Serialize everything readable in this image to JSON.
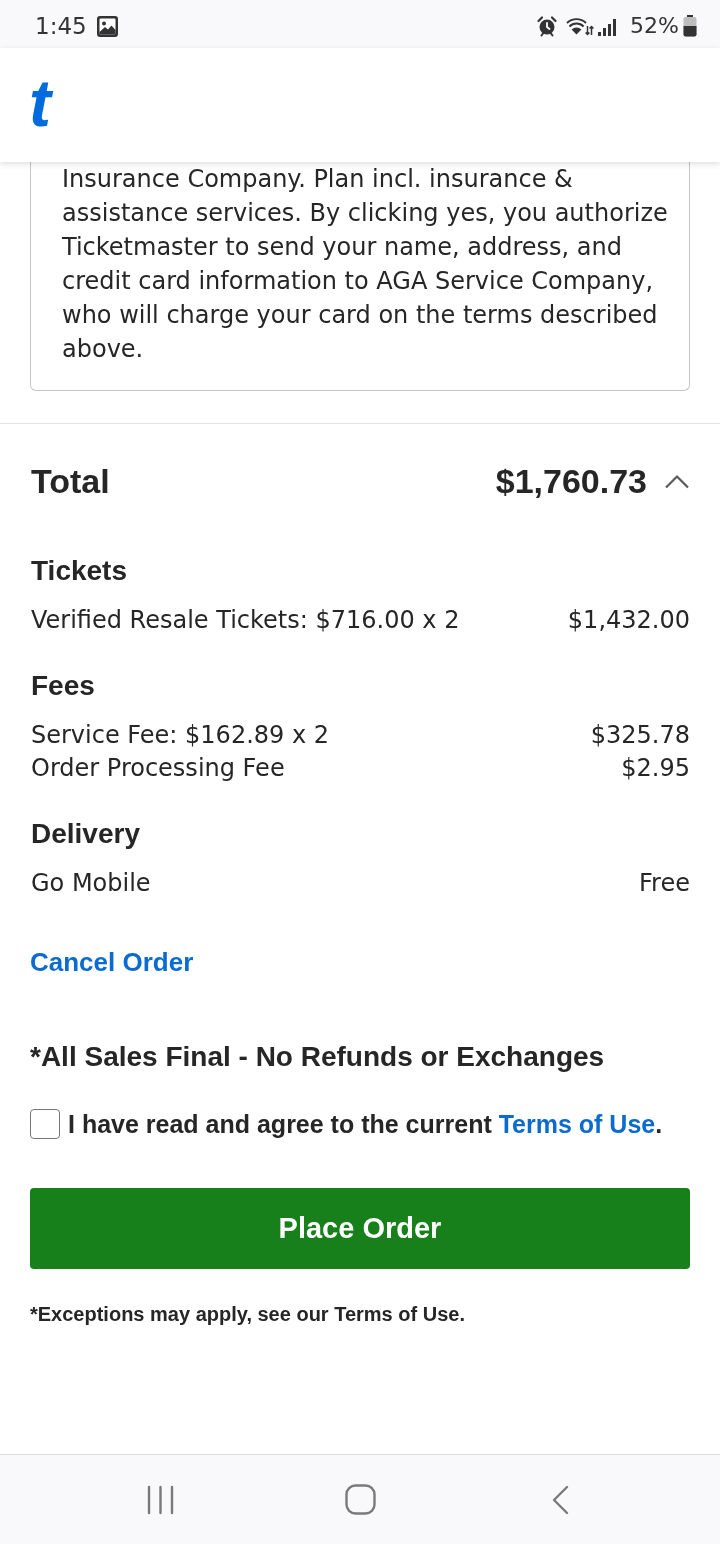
{
  "status_bar": {
    "time": "1:45",
    "battery": "52%"
  },
  "header": {
    "logo": "t"
  },
  "insurance_notice": {
    "text": "Insurance Company. Plan incl. insurance & assistance services. By clicking yes, you authorize Ticketmaster to send your name, address, and credit card information to AGA Service Company, who will charge your card on the terms described above."
  },
  "total": {
    "label": "Total",
    "amount": "$1,760.73",
    "expanded": true
  },
  "breakdown": [
    {
      "heading": "Tickets",
      "items": [
        {
          "label": "Verified Resale Tickets: $716.00 x 2",
          "amount": "$1,432.00"
        }
      ]
    },
    {
      "heading": "Fees",
      "items": [
        {
          "label": "Service Fee: $162.89 x 2",
          "amount": "$325.78"
        },
        {
          "label": "Order Processing Fee",
          "amount": "$2.95"
        }
      ]
    },
    {
      "heading": "Delivery",
      "items": [
        {
          "label": "Go Mobile",
          "amount": "Free"
        }
      ]
    }
  ],
  "cancel_link": "Cancel Order",
  "sales_notice": "*All Sales Final - No Refunds or Exchanges",
  "agreement": {
    "checked": false,
    "text": "I have read and agree to the current ",
    "link": "Terms of Use",
    "suffix": "."
  },
  "place_order_button": "Place Order",
  "footnote": "*Exceptions may apply, see our Terms of Use."
}
